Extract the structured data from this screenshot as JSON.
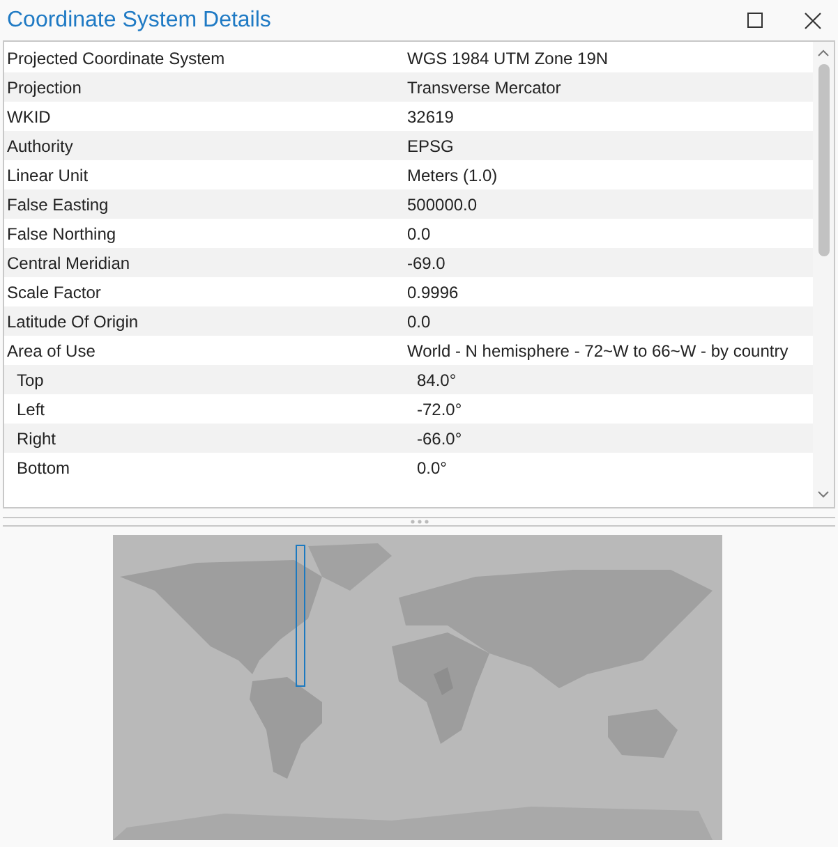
{
  "window": {
    "title": "Coordinate System Details"
  },
  "properties": [
    {
      "name": "Projected Coordinate System",
      "value": "WGS 1984 UTM Zone 19N"
    },
    {
      "name": "Projection",
      "value": "Transverse Mercator"
    },
    {
      "name": "WKID",
      "value": "32619"
    },
    {
      "name": "Authority",
      "value": "EPSG"
    },
    {
      "name": "Linear Unit",
      "value": "Meters (1.0)"
    },
    {
      "name": "False Easting",
      "value": "500000.0"
    },
    {
      "name": "False Northing",
      "value": "0.0"
    },
    {
      "name": "Central Meridian",
      "value": "-69.0"
    },
    {
      "name": "Scale Factor",
      "value": "0.9996"
    },
    {
      "name": "Latitude Of Origin",
      "value": "0.0"
    },
    {
      "name": "Area of Use",
      "value": "World - N hemisphere - 72~W to 66~W - by country",
      "children": [
        {
          "name": "Top",
          "value": "84.0°"
        },
        {
          "name": "Left",
          "value": "-72.0°"
        },
        {
          "name": "Right",
          "value": "-66.0°"
        },
        {
          "name": "Bottom",
          "value": "0.0°"
        }
      ]
    }
  ]
}
